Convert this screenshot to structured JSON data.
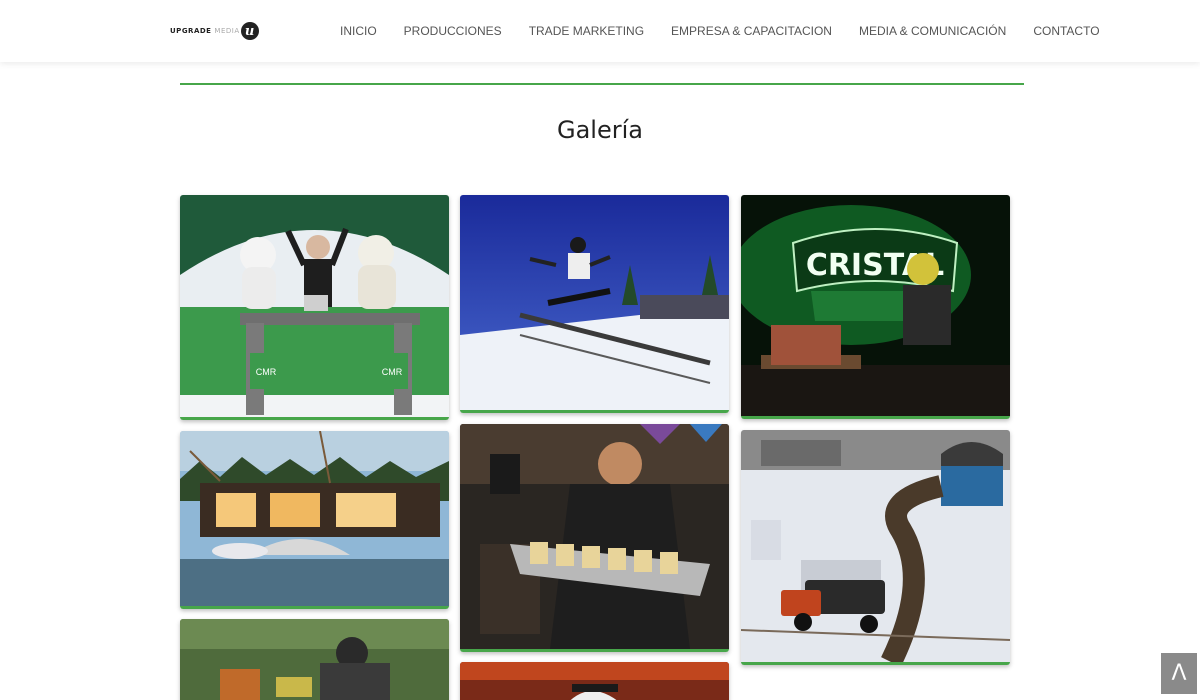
{
  "logo": {
    "text_bold": "UPGRADE",
    "text_faded": "MEDIA"
  },
  "nav": {
    "items": [
      "INICIO",
      "PRODUCCIONES",
      "TRADE MARKETING",
      "EMPRESA & CAPACITACION",
      "MEDIA & COMUNICACIÓN",
      "CONTACTO"
    ]
  },
  "gallery": {
    "title": "Galería",
    "accent_color": "#47a64a",
    "tiles": [
      {
        "name": "dj-booth-photo",
        "sign_left": "CMR",
        "sign_right": "CMR"
      },
      {
        "name": "snowboard-rail-photo"
      },
      {
        "name": "cristal-light-event-photo",
        "sign": "CRISTAL"
      },
      {
        "name": "waterfront-stage-photo"
      },
      {
        "name": "waiter-tray-photo"
      },
      {
        "name": "snow-4x4-course-photo"
      },
      {
        "name": "motorcycle-photo"
      },
      {
        "name": "helmet-event-photo"
      }
    ]
  },
  "scroll_top": {
    "icon": "chevron-up-icon",
    "glyph": "Λ"
  }
}
